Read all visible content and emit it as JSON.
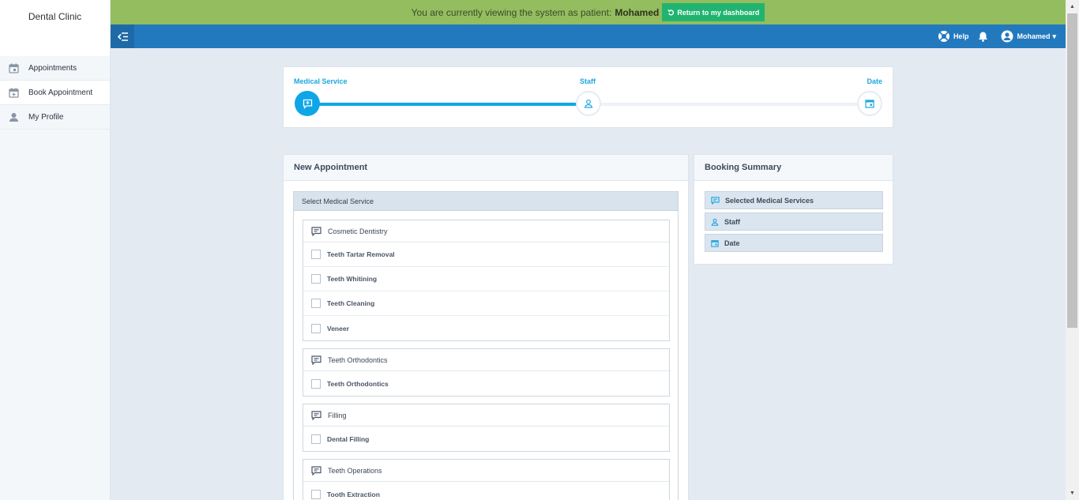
{
  "sidebar": {
    "brand": "Dental Clinic",
    "items": [
      {
        "label": "Appointments",
        "icon": "calendar-icon"
      },
      {
        "label": "Book Appointment",
        "icon": "calendar-plus-icon"
      },
      {
        "label": "My Profile",
        "icon": "user-icon"
      }
    ]
  },
  "notice": {
    "text": "You are currently viewing the system as patient:",
    "patient": "Mohamed",
    "return_label": "Return to my dashboard"
  },
  "header": {
    "help_label": "Help",
    "user_label": "Mohamed"
  },
  "stepper": {
    "steps": [
      {
        "label": "Medical Service",
        "state": "active"
      },
      {
        "label": "Staff",
        "state": "idle"
      },
      {
        "label": "Date",
        "state": "idle"
      }
    ]
  },
  "new_appointment": {
    "title": "New Appointment",
    "section_title": "Select Medical Service",
    "groups": [
      {
        "name": "Cosmetic Dentistry",
        "services": [
          "Teeth Tartar Removal",
          "Teeth Whitining",
          "Teeth Cleaning",
          "Veneer"
        ]
      },
      {
        "name": "Teeth Orthodontics",
        "services": [
          "Teeth Orthodontics"
        ]
      },
      {
        "name": "Filling",
        "services": [
          "Dental Filling"
        ]
      },
      {
        "name": "Teeth Operations",
        "services": [
          "Tooth Extraction"
        ]
      }
    ]
  },
  "booking_summary": {
    "title": "Booking Summary",
    "items": [
      "Selected Medical Services",
      "Staff",
      "Date"
    ]
  },
  "colors": {
    "notice_bg": "#93bd5f",
    "return_button": "#21b470",
    "header_bg": "#2379be",
    "accent": "#0fa6e8"
  }
}
